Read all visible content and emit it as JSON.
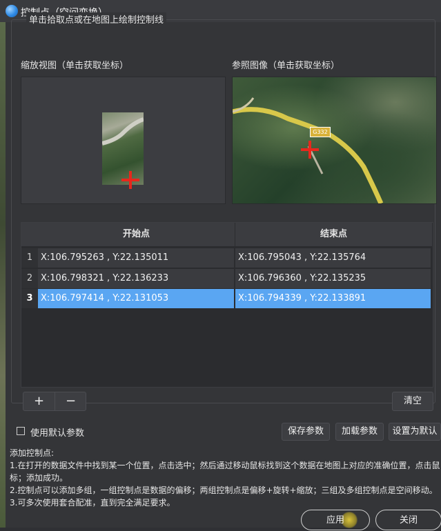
{
  "window": {
    "title": "控制点（空间变换）"
  },
  "group": {
    "title": "单击拾取点或在地图上绘制控制线"
  },
  "zoom_view": {
    "label": "缩放视图（单击获取坐标）"
  },
  "reference_view": {
    "label": "参照图像（单击获取坐标）",
    "road_sign": "G332"
  },
  "table": {
    "headers": [
      "开始点",
      "结束点"
    ],
    "rows": [
      {
        "num": "1",
        "start": "X:106.795263 , Y:22.135011",
        "end": "X:106.795043 , Y:22.135764",
        "selected": false
      },
      {
        "num": "2",
        "start": "X:106.798321 , Y:22.136233",
        "end": "X:106.796360 , Y:22.135235",
        "selected": false
      },
      {
        "num": "3",
        "start": "X:106.797414 , Y:22.131053",
        "end": "X:106.794339 , Y:22.133891",
        "selected": true
      }
    ]
  },
  "buttons": {
    "add": "+",
    "remove": "−",
    "clear": "清空",
    "use_default": "使用默认参数",
    "save_params": "保存参数",
    "load_params": "加载参数",
    "set_default": "设置为默认",
    "apply": "应用",
    "close": "关闭"
  },
  "help": {
    "title": "添加控制点:",
    "line1": "1.在打开的数据文件中找到某一个位置，点击选中；然后通过移动鼠标找到这个数据在地图上对应的准确位置，点击鼠",
    "line1b": "标；添加成功。",
    "line2": "2.控制点可以添加多组，一组控制点是数据的偏移；两组控制点是偏移+旋转+缩放；三组及多组控制点是空间移动。",
    "line3": "3.可多次使用套合配准，直到完全满足要求。"
  },
  "colors": {
    "selected_row": "#5aa6f2",
    "crosshair": "#e8271c",
    "road": "#d8c84a"
  }
}
